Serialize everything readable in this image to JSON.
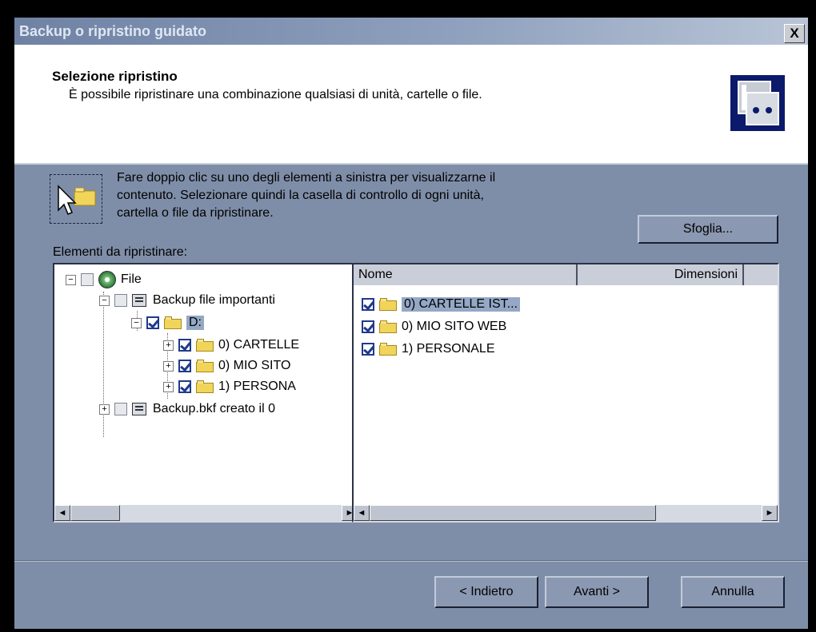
{
  "window": {
    "title": "Backup o ripristino guidato",
    "close_label": "X"
  },
  "header": {
    "title": "Selezione ripristino",
    "subtitle": "È possibile ripristinare una combinazione qualsiasi di unità, cartelle o file."
  },
  "instructions": {
    "line1": "Fare doppio clic su uno degli elementi a sinistra per visualizzarne il",
    "line2": "contenuto. Selezionare quindi la casella di controllo di ogni unità,",
    "line3": "cartella o file da ripristinare."
  },
  "browse_label": "Sfoglia...",
  "items_label": "Elementi da ripristinare:",
  "tree": {
    "root": {
      "label": "File",
      "expander": "−",
      "checked": false
    },
    "backup_important": {
      "label": "Backup file importanti",
      "expander": "−",
      "checked": false
    },
    "drive_d": {
      "label": "D:",
      "expander": "−",
      "checked": true
    },
    "folder_cartelle": {
      "label": "0) CARTELLE",
      "expander": "+",
      "checked": true
    },
    "folder_mio_sito": {
      "label": "0) MIO  SITO",
      "expander": "+",
      "checked": true
    },
    "folder_personale": {
      "label": "1) PERSONA",
      "expander": "+",
      "checked": true
    },
    "backup_bkf": {
      "label": "Backup.bkf creato il 0",
      "expander": "+",
      "checked": false
    }
  },
  "list": {
    "columns": {
      "name": "Nome",
      "size": "Dimensioni"
    },
    "rows": [
      {
        "name": "0) CARTELLE IST...",
        "checked": true
      },
      {
        "name": "0) MIO  SITO WEB",
        "checked": true
      },
      {
        "name": "1) PERSONALE",
        "checked": true
      }
    ]
  },
  "scroll": {
    "left_arrow": "◄",
    "right_arrow": "►"
  },
  "buttons": {
    "back": "< Indietro",
    "next": "Avanti >",
    "cancel": "Annulla"
  },
  "colors": {
    "background": "#7f8ea8",
    "header_bg": "#ffffff",
    "selection": "#94a8c6",
    "check": "#1f3a8a"
  }
}
